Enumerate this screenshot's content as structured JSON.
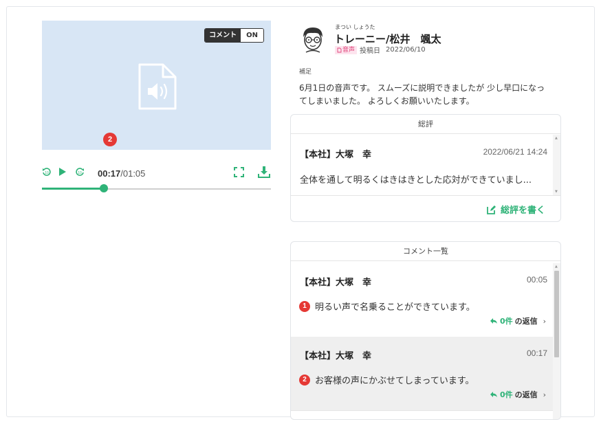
{
  "player": {
    "comment_toggle_label": "コメント",
    "comment_toggle_state": "ON",
    "marker_number": "2",
    "current_time": "00:17",
    "total_time": "/01:05",
    "progress_fraction": 0.27,
    "accent_color": "#2fb378"
  },
  "post": {
    "ruby": "まつい しょうた",
    "author_name": "トレーニー/松井　颯太",
    "media_tag": "音声",
    "posted_label": "投稿日",
    "posted_date": "2022/06/10",
    "supplement_label": "補足",
    "description": "6月1日の音声です。 スムーズに説明できましたが 少し早口になってしまいました。 よろしくお願いいたします。"
  },
  "review": {
    "title": "総評",
    "author": "【本社】大塚　幸",
    "date": "2022/06/21 14:24",
    "text": "全体を通して明るくはきはきとした応対ができていまし...",
    "write_label": "総評を書く"
  },
  "comments": {
    "title": "コメント一覧",
    "items": [
      {
        "author": "【本社】大塚　幸",
        "time": "00:05",
        "number": "1",
        "text": "明るい声で名乗ることができています。",
        "reply_count": "0件",
        "reply_label": "の返信",
        "chevron": "›"
      },
      {
        "author": "【本社】大塚　幸",
        "time": "00:17",
        "number": "2",
        "text": "お客様の声にかぶせてしまっています。",
        "reply_count": "0件",
        "reply_label": "の返信",
        "chevron": "›"
      }
    ]
  }
}
